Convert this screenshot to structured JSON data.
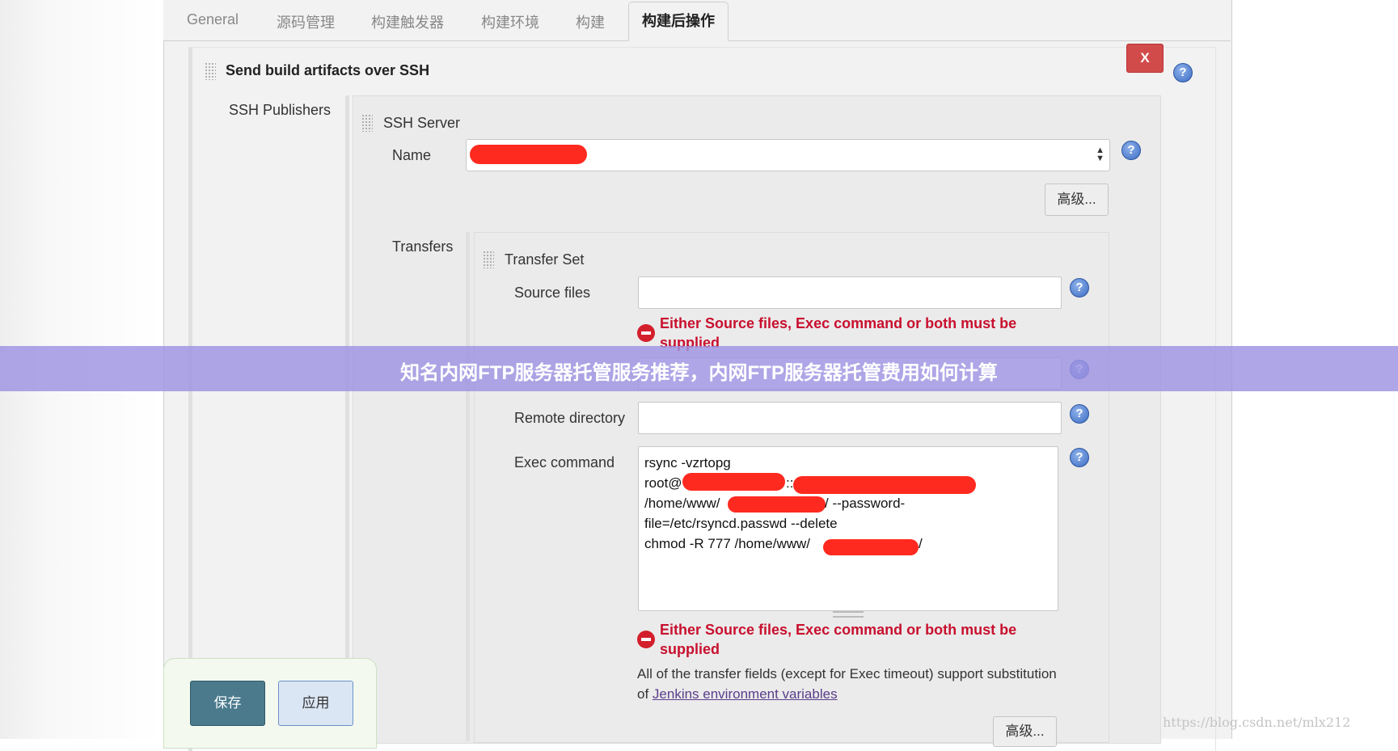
{
  "tabs": [
    "General",
    "源码管理",
    "构建触发器",
    "构建环境",
    "构建",
    "构建后操作"
  ],
  "section_title": "Send build artifacts over SSH",
  "close_label": "X",
  "help_glyph": "?",
  "ssh_publishers_label": "SSH Publishers",
  "ssh_server_title": "SSH Server",
  "name_label": "Name",
  "advanced_label": "高级...",
  "transfers_label": "Transfers",
  "transfer_set_title": "Transfer Set",
  "source_files_label": "Source files",
  "source_files_value": "",
  "error_message": "Either Source files, Exec command or both must be supplied",
  "remote_directory_label": "Remote directory",
  "remote_directory_value": "",
  "exec_command_label": "Exec command",
  "exec_lines": {
    "l1": "rsync -vzrtopg",
    "l2a": "root@",
    "l2b": "::",
    "l3a": "/home/www/",
    "l3b": "/ --password-",
    "l4": "file=/etc/rsyncd.passwd --delete",
    "l5a": "chmod -R 777 /home/www/",
    "l5b": "/"
  },
  "note_text": "All of the transfer fields (except for Exec timeout) support substitution of ",
  "note_link": "Jenkins environment variables",
  "banner_text": "知名内网FTP服务器托管服务推荐，内网FTP服务器托管费用如何计算",
  "save_label": "保存",
  "apply_label": "应用",
  "watermark": "https://blog.csdn.net/mlx212",
  "colors": {
    "redaction": "#ff2a1f",
    "error": "#c8102e",
    "banner": "#9e92e2",
    "save": "#4a7a8c"
  }
}
